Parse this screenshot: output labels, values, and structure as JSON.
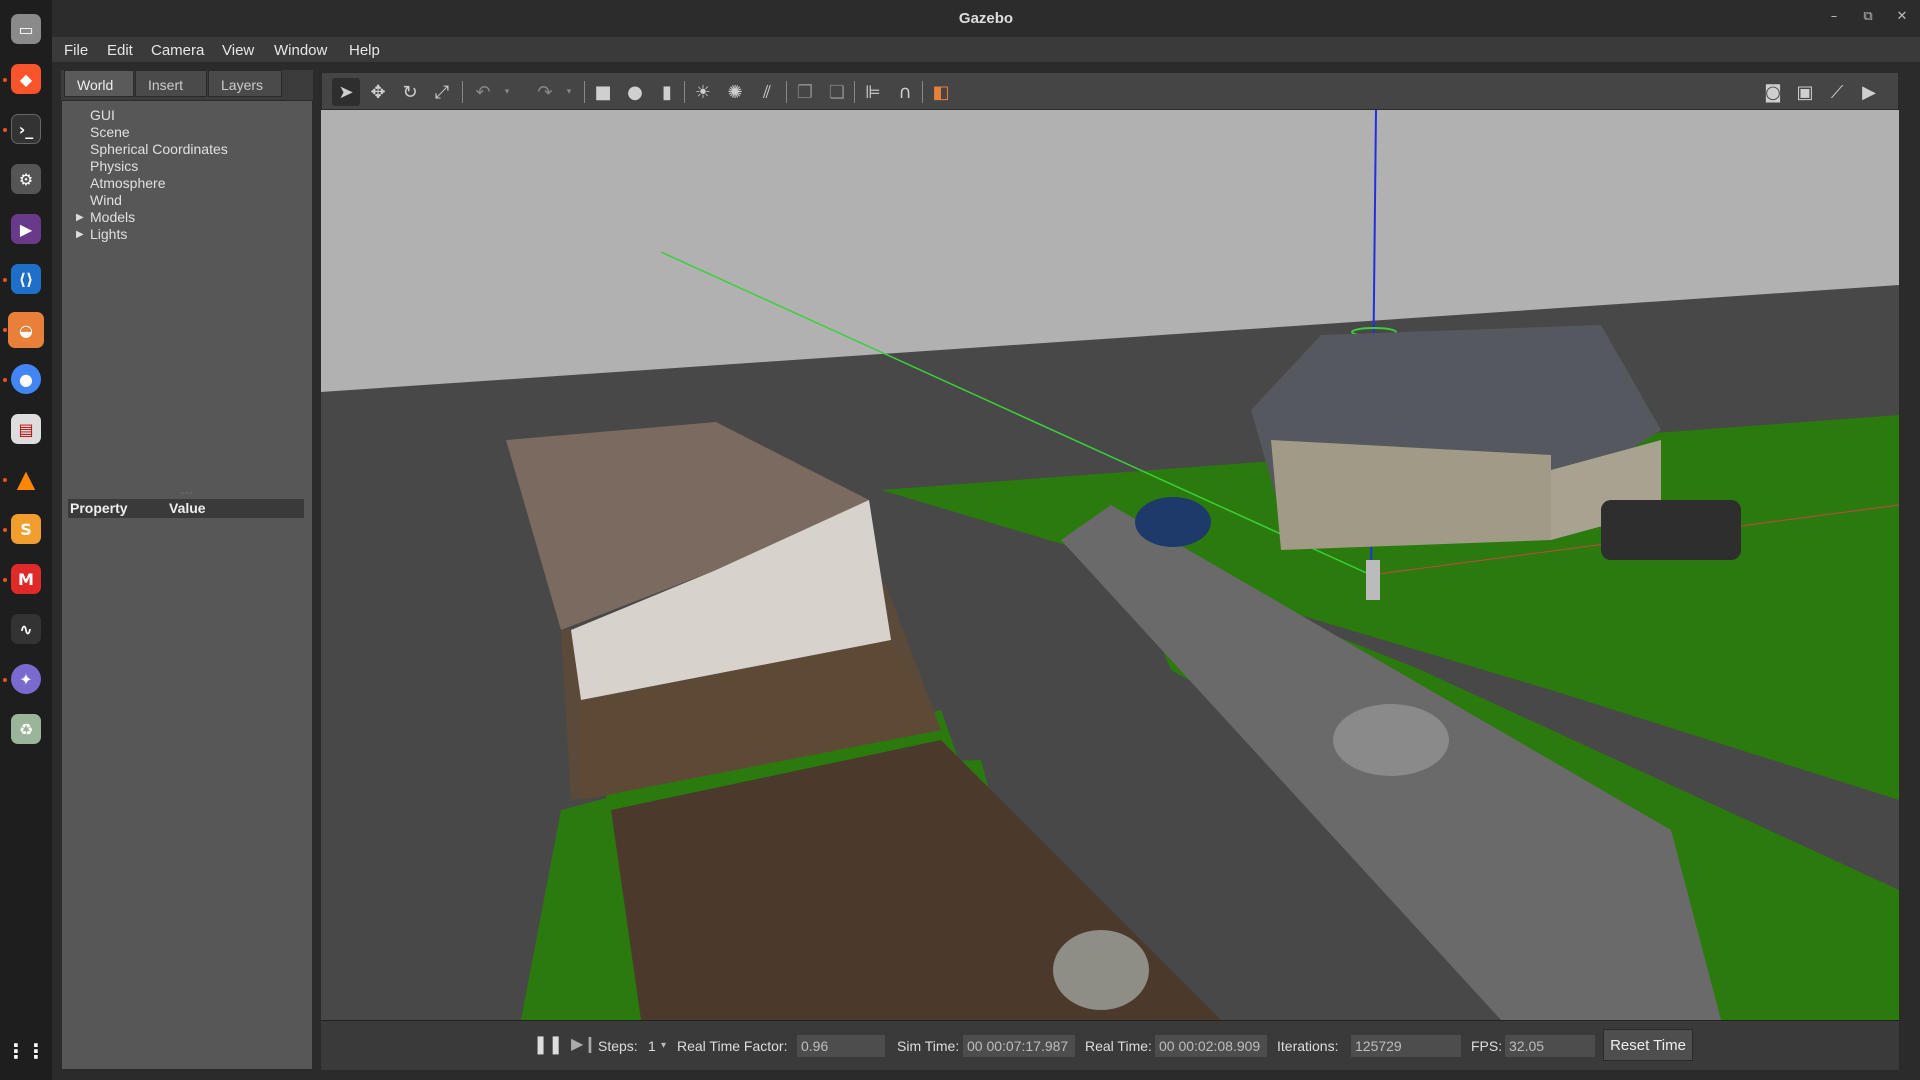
{
  "window": {
    "title": "Gazebo"
  },
  "menubar": {
    "items": [
      "File",
      "Edit",
      "Camera",
      "View",
      "Window",
      "Help"
    ]
  },
  "left_panel": {
    "tabs": [
      "World",
      "Insert",
      "Layers"
    ],
    "tree": [
      "GUI",
      "Scene",
      "Spherical Coordinates",
      "Physics",
      "Atmosphere",
      "Wind",
      "Models",
      "Lights"
    ],
    "property_header": {
      "property": "Property",
      "value": "Value"
    }
  },
  "toolbar": {
    "tools": [
      "select-arrow-icon",
      "translate-icon",
      "rotate-icon",
      "scale-icon",
      "undo-icon",
      "redo-icon",
      "box-icon",
      "sphere-icon",
      "cylinder-icon",
      "point-light-icon",
      "spot-light-icon",
      "directional-light-icon",
      "copy-icon",
      "paste-icon",
      "align-icon",
      "snap-icon",
      "view-angle-icon",
      "screenshot-icon",
      "log-icon",
      "plot-icon",
      "video-record-icon"
    ]
  },
  "statusbar": {
    "steps_label": "Steps:",
    "steps_value": "1",
    "rtf_label": "Real Time Factor:",
    "rtf_value": "0.96",
    "sim_time_label": "Sim Time:",
    "sim_time_value": "00 00:07:17.987",
    "real_time_label": "Real Time:",
    "real_time_value": "00 00:02:08.909",
    "iterations_label": "Iterations:",
    "iterations_value": "125729",
    "fps_label": "FPS:",
    "fps_value": "32.05",
    "reset_label": "Reset Time"
  },
  "colors": {
    "sky": "#b1b1b1",
    "grass": "#2a7a0e",
    "road": "#4a4a4a",
    "dock_accent": "#e95420"
  }
}
